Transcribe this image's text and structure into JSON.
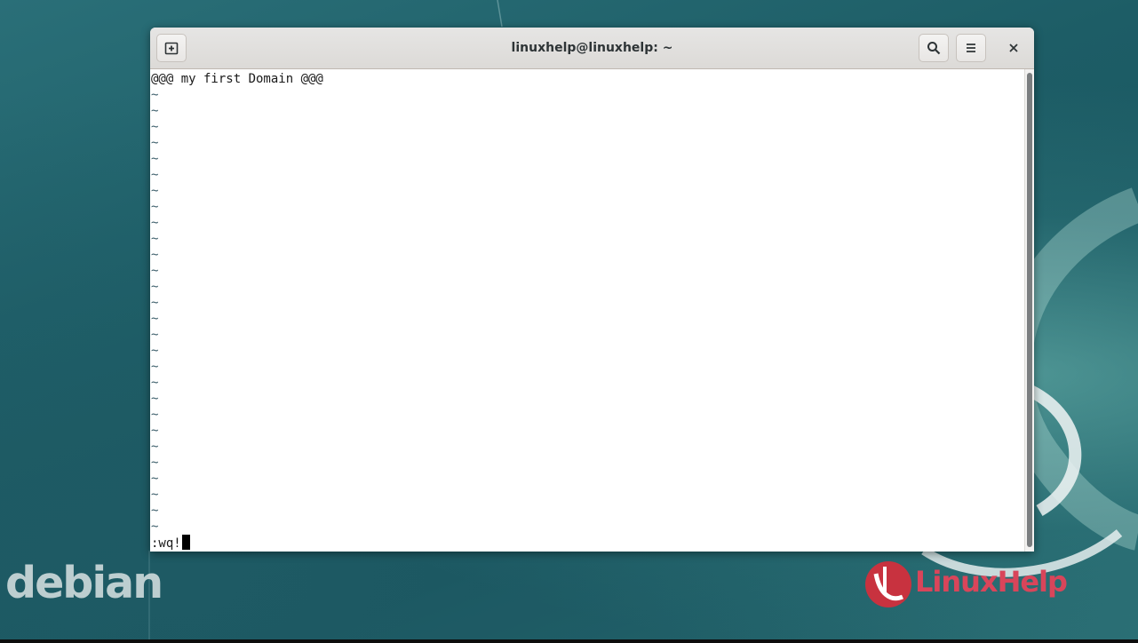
{
  "desktop": {
    "os_logo_text": "debian",
    "watermark_text": "LinuxHelp"
  },
  "window": {
    "title": "linuxhelp@linuxhelp: ~",
    "new_tab_icon": "new-tab-icon",
    "search_icon": "search-icon",
    "menu_icon": "hamburger-menu-icon",
    "close_icon": "close-icon"
  },
  "terminal": {
    "first_line": "@@@ my first Domain @@@",
    "tilde_char": "~",
    "tilde_count": 28,
    "command_line": ":wq!"
  }
}
